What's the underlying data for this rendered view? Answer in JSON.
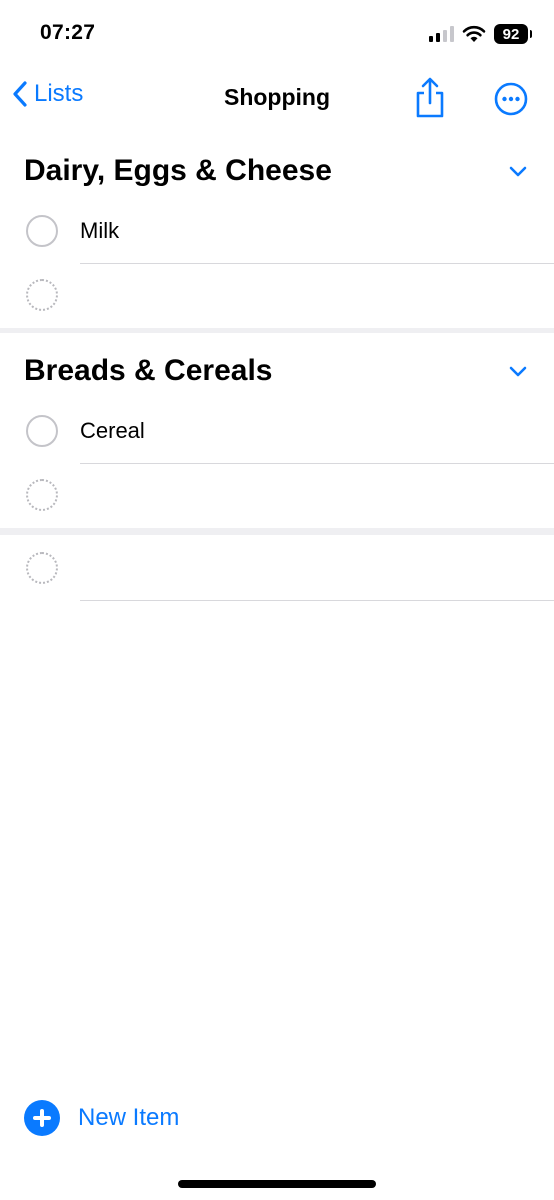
{
  "status_bar": {
    "time": "07:27",
    "battery": "92"
  },
  "nav": {
    "back_label": "Lists",
    "title": "Shopping"
  },
  "sections": [
    {
      "title": "Dairy, Eggs & Cheese",
      "items": [
        "Milk"
      ]
    },
    {
      "title": "Breads & Cereals",
      "items": [
        "Cereal"
      ]
    }
  ],
  "footer": {
    "new_item_label": "New Item"
  },
  "colors": {
    "accent": "#0a7aff",
    "circle": "#c4c4c9",
    "divider": "#d8d8dc"
  }
}
